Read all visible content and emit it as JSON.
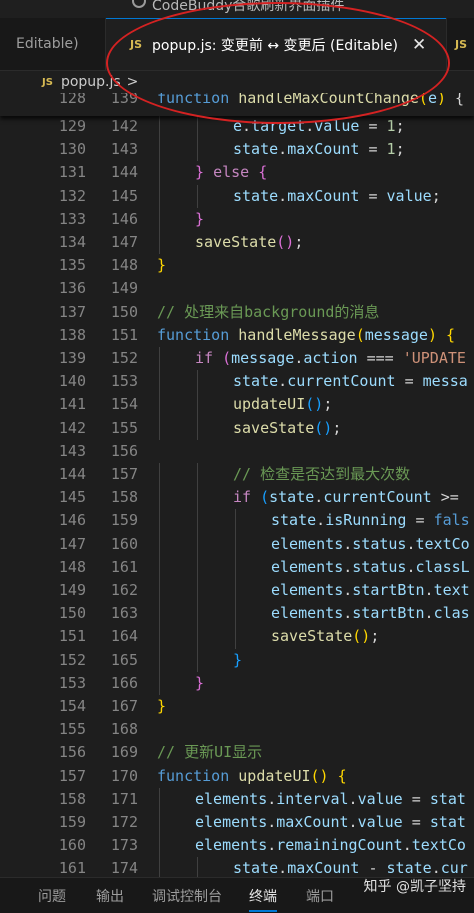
{
  "window": {
    "title": "CodeBuddy合歌刷新界面插件"
  },
  "tabs": [
    {
      "label": "Editable)"
    },
    {
      "icon": "JS",
      "label": "popup.js: 变更前 ↔ 变更后 (Editable)",
      "close": "✕"
    },
    {
      "icon": "JS"
    }
  ],
  "breadcrumb": {
    "icon": "JS",
    "file": "popup.js",
    "separator": ">"
  },
  "sticky": {
    "left": "128",
    "right": "139",
    "tokens": [
      [
        "kw",
        "function "
      ],
      [
        "fn",
        "handleMaxCountChange"
      ],
      [
        "b1",
        "("
      ],
      [
        "var",
        "e"
      ],
      [
        "b1",
        ")"
      ],
      [
        "op",
        " {"
      ]
    ]
  },
  "lines": [
    {
      "left": "129",
      "right": "142",
      "indent": 2,
      "tokens": [
        [
          "var",
          "e"
        ],
        [
          "op",
          "."
        ],
        [
          "var",
          "target"
        ],
        [
          "op",
          "."
        ],
        [
          "var",
          "value"
        ],
        [
          "op",
          " = "
        ],
        [
          "num",
          "1"
        ],
        [
          "op",
          ";"
        ]
      ]
    },
    {
      "left": "130",
      "right": "143",
      "indent": 2,
      "tokens": [
        [
          "var",
          "state"
        ],
        [
          "op",
          "."
        ],
        [
          "var",
          "maxCount"
        ],
        [
          "op",
          " = "
        ],
        [
          "num",
          "1"
        ],
        [
          "op",
          ";"
        ]
      ]
    },
    {
      "left": "131",
      "right": "144",
      "indent": 1,
      "tokens": [
        [
          "b2",
          "}"
        ],
        [
          "op",
          " "
        ],
        [
          "ctl",
          "else"
        ],
        [
          "op",
          " "
        ],
        [
          "b2",
          "{"
        ]
      ]
    },
    {
      "left": "132",
      "right": "145",
      "indent": 2,
      "tokens": [
        [
          "var",
          "state"
        ],
        [
          "op",
          "."
        ],
        [
          "var",
          "maxCount"
        ],
        [
          "op",
          " = "
        ],
        [
          "var",
          "value"
        ],
        [
          "op",
          ";"
        ]
      ]
    },
    {
      "left": "133",
      "right": "146",
      "indent": 1,
      "tokens": [
        [
          "b2",
          "}"
        ]
      ]
    },
    {
      "left": "134",
      "right": "147",
      "indent": 1,
      "tokens": [
        [
          "fn",
          "saveState"
        ],
        [
          "b2",
          "()"
        ],
        [
          "op",
          ";"
        ]
      ]
    },
    {
      "left": "135",
      "right": "148",
      "indent": 0,
      "tokens": [
        [
          "b1",
          "}"
        ]
      ]
    },
    {
      "left": "136",
      "right": "149",
      "indent": 0,
      "tokens": []
    },
    {
      "left": "137",
      "right": "150",
      "indent": 0,
      "tokens": [
        [
          "cmt",
          "// 处理来自background的消息"
        ]
      ]
    },
    {
      "left": "138",
      "right": "151",
      "indent": 0,
      "tokens": [
        [
          "kw",
          "function "
        ],
        [
          "fn",
          "handleMessage"
        ],
        [
          "b1",
          "("
        ],
        [
          "var",
          "message"
        ],
        [
          "b1",
          ")"
        ],
        [
          "op",
          " "
        ],
        [
          "b1",
          "{"
        ]
      ]
    },
    {
      "left": "139",
      "right": "152",
      "indent": 1,
      "tokens": [
        [
          "ctl",
          "if"
        ],
        [
          "op",
          " "
        ],
        [
          "b2",
          "("
        ],
        [
          "var",
          "message"
        ],
        [
          "op",
          "."
        ],
        [
          "var",
          "action"
        ],
        [
          "op",
          " === "
        ],
        [
          "str",
          "'UPDATE"
        ]
      ]
    },
    {
      "left": "140",
      "right": "153",
      "indent": 2,
      "tokens": [
        [
          "var",
          "state"
        ],
        [
          "op",
          "."
        ],
        [
          "var",
          "currentCount"
        ],
        [
          "op",
          " = "
        ],
        [
          "var",
          "messa"
        ]
      ]
    },
    {
      "left": "141",
      "right": "154",
      "indent": 2,
      "tokens": [
        [
          "fn",
          "updateUI"
        ],
        [
          "b3",
          "()"
        ],
        [
          "op",
          ";"
        ]
      ]
    },
    {
      "left": "142",
      "right": "155",
      "indent": 2,
      "tokens": [
        [
          "fn",
          "saveState"
        ],
        [
          "b3",
          "()"
        ],
        [
          "op",
          ";"
        ]
      ]
    },
    {
      "left": "143",
      "right": "156",
      "indent": 0,
      "tokens": []
    },
    {
      "left": "144",
      "right": "157",
      "indent": 2,
      "tokens": [
        [
          "cmt",
          "// 检查是否达到最大次数"
        ]
      ]
    },
    {
      "left": "145",
      "right": "158",
      "indent": 2,
      "tokens": [
        [
          "ctl",
          "if"
        ],
        [
          "op",
          " "
        ],
        [
          "b3",
          "("
        ],
        [
          "var",
          "state"
        ],
        [
          "op",
          "."
        ],
        [
          "var",
          "currentCount"
        ],
        [
          "op",
          " >="
        ]
      ]
    },
    {
      "left": "146",
      "right": "159",
      "indent": 3,
      "tokens": [
        [
          "var",
          "state"
        ],
        [
          "op",
          "."
        ],
        [
          "var",
          "isRunning"
        ],
        [
          "op",
          " = "
        ],
        [
          "kw",
          "fals"
        ]
      ]
    },
    {
      "left": "147",
      "right": "160",
      "indent": 3,
      "tokens": [
        [
          "var",
          "elements"
        ],
        [
          "op",
          "."
        ],
        [
          "var",
          "status"
        ],
        [
          "op",
          "."
        ],
        [
          "var",
          "textCo"
        ]
      ]
    },
    {
      "left": "148",
      "right": "161",
      "indent": 3,
      "tokens": [
        [
          "var",
          "elements"
        ],
        [
          "op",
          "."
        ],
        [
          "var",
          "status"
        ],
        [
          "op",
          "."
        ],
        [
          "var",
          "classL"
        ]
      ]
    },
    {
      "left": "149",
      "right": "162",
      "indent": 3,
      "tokens": [
        [
          "var",
          "elements"
        ],
        [
          "op",
          "."
        ],
        [
          "var",
          "startBtn"
        ],
        [
          "op",
          "."
        ],
        [
          "var",
          "text"
        ]
      ]
    },
    {
      "left": "150",
      "right": "163",
      "indent": 3,
      "tokens": [
        [
          "var",
          "elements"
        ],
        [
          "op",
          "."
        ],
        [
          "var",
          "startBtn"
        ],
        [
          "op",
          "."
        ],
        [
          "var",
          "clas"
        ]
      ]
    },
    {
      "left": "151",
      "right": "164",
      "indent": 3,
      "tokens": [
        [
          "fn",
          "saveState"
        ],
        [
          "b1",
          "()"
        ],
        [
          "op",
          ";"
        ]
      ]
    },
    {
      "left": "152",
      "right": "165",
      "indent": 2,
      "tokens": [
        [
          "b3",
          "}"
        ]
      ]
    },
    {
      "left": "153",
      "right": "166",
      "indent": 1,
      "tokens": [
        [
          "b2",
          "}"
        ]
      ]
    },
    {
      "left": "154",
      "right": "167",
      "indent": 0,
      "tokens": [
        [
          "b1",
          "}"
        ]
      ]
    },
    {
      "left": "155",
      "right": "168",
      "indent": 0,
      "tokens": []
    },
    {
      "left": "156",
      "right": "169",
      "indent": 0,
      "tokens": [
        [
          "cmt",
          "// 更新UI显示"
        ]
      ]
    },
    {
      "left": "157",
      "right": "170",
      "indent": 0,
      "tokens": [
        [
          "kw",
          "function "
        ],
        [
          "fn",
          "updateUI"
        ],
        [
          "b1",
          "()"
        ],
        [
          "op",
          " "
        ],
        [
          "b1",
          "{"
        ]
      ]
    },
    {
      "left": "158",
      "right": "171",
      "indent": 1,
      "tokens": [
        [
          "var",
          "elements"
        ],
        [
          "op",
          "."
        ],
        [
          "var",
          "interval"
        ],
        [
          "op",
          "."
        ],
        [
          "var",
          "value"
        ],
        [
          "op",
          " = "
        ],
        [
          "var",
          "stat"
        ]
      ]
    },
    {
      "left": "159",
      "right": "172",
      "indent": 1,
      "tokens": [
        [
          "var",
          "elements"
        ],
        [
          "op",
          "."
        ],
        [
          "var",
          "maxCount"
        ],
        [
          "op",
          "."
        ],
        [
          "var",
          "value"
        ],
        [
          "op",
          " = "
        ],
        [
          "var",
          "stat"
        ]
      ]
    },
    {
      "left": "160",
      "right": "173",
      "indent": 1,
      "tokens": [
        [
          "var",
          "elements"
        ],
        [
          "op",
          "."
        ],
        [
          "var",
          "remainingCount"
        ],
        [
          "op",
          "."
        ],
        [
          "var",
          "textCo"
        ]
      ]
    },
    {
      "left": "161",
      "right": "174",
      "indent": 2,
      "tokens": [
        [
          "var",
          "state"
        ],
        [
          "op",
          "."
        ],
        [
          "var",
          "maxCount"
        ],
        [
          "op",
          " - "
        ],
        [
          "var",
          "state"
        ],
        [
          "op",
          "."
        ],
        [
          "var",
          "cur"
        ]
      ]
    }
  ],
  "panel": {
    "tabs": [
      "问题",
      "输出",
      "调试控制台",
      "终端",
      "端口"
    ],
    "active": "终端"
  },
  "watermark": "知乎 @凯子坚持",
  "colors": {
    "accent": "#0078d4",
    "annotation": "#d42222",
    "keyword": "#569cd6",
    "function": "#dcdcaa",
    "variable": "#9cdcfe",
    "comment": "#6a9955"
  }
}
